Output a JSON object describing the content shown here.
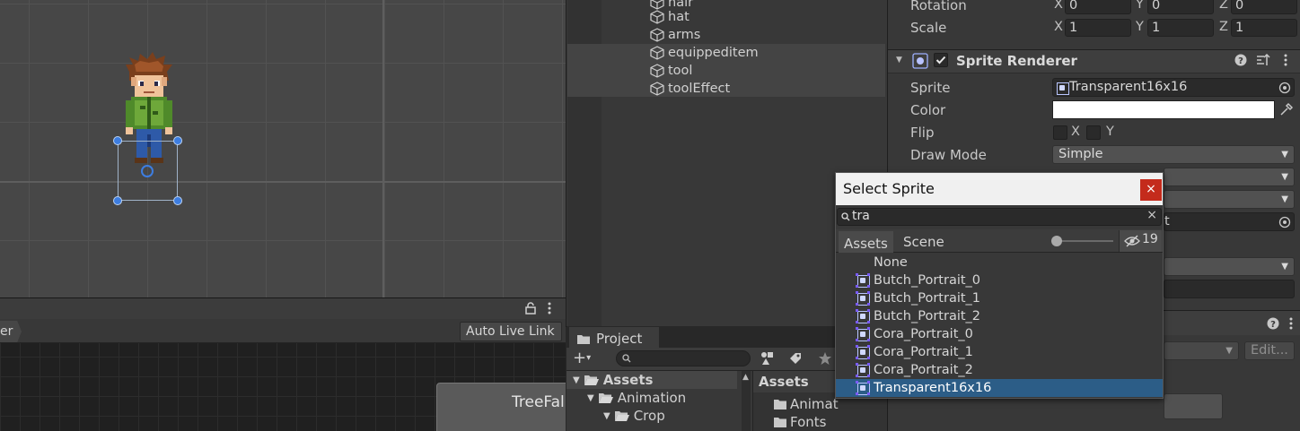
{
  "scene": {},
  "animator": {
    "breadcrumb_tail": "er",
    "auto_live_link": "Auto Live Link",
    "state_node": "TreeFal"
  },
  "hierarchy": {
    "items": [
      {
        "label": "hair"
      },
      {
        "label": "hat"
      },
      {
        "label": "arms"
      },
      {
        "label": "equippeditem"
      },
      {
        "label": "tool"
      },
      {
        "label": "toolEffect"
      }
    ]
  },
  "project": {
    "tab": "Project",
    "tree": [
      {
        "label": "Assets"
      },
      {
        "label": "Animation"
      },
      {
        "label": "Crop"
      }
    ],
    "assets_header": "Assets",
    "assets_items": [
      {
        "label": "Animat"
      },
      {
        "label": "Fonts"
      }
    ]
  },
  "inspector": {
    "rotation_label": "Rotation",
    "scale_label": "Scale",
    "rotation": {
      "x": "0",
      "y": "0",
      "z": "0"
    },
    "scale": {
      "x": "1",
      "y": "1",
      "z": "1"
    },
    "axis_x": "X",
    "axis_y": "Y",
    "axis_z": "Z",
    "component_title": "Sprite Renderer",
    "sprite_label": "Sprite",
    "sprite_value": "Transparent16x16",
    "color_label": "Color",
    "color_value": "#ffffff",
    "flip_label": "Flip",
    "flip_x": "X",
    "flip_y": "Y",
    "draw_mode_label": "Draw Mode",
    "draw_mode_value": "Simple",
    "partial_text": "t",
    "edit_button": "Edit..."
  },
  "popup": {
    "title": "Select Sprite",
    "close": "×",
    "search_value": "tra",
    "tabs": [
      "Assets",
      "Scene"
    ],
    "hidden_count": "19",
    "none_label": "None",
    "items": [
      {
        "label": "Butch_Portrait_0"
      },
      {
        "label": "Butch_Portrait_1"
      },
      {
        "label": "Butch_Portrait_2"
      },
      {
        "label": "Cora_Portrait_0"
      },
      {
        "label": "Cora_Portrait_1"
      },
      {
        "label": "Cora_Portrait_2"
      },
      {
        "label": "Transparent16x16"
      }
    ],
    "selected_index": 6
  }
}
